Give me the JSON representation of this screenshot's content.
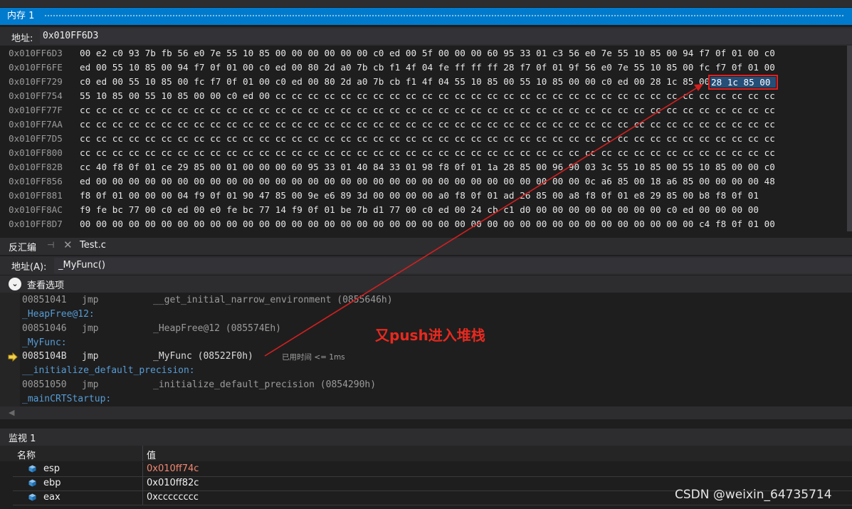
{
  "memory": {
    "title": "内存 1",
    "address_label": "地址:",
    "address_value": "0x010FF6D3",
    "rows": [
      {
        "addr": "0x010FF6D3",
        "bytes": "00 e2 c0 93 7b fb 56 e0 7e 55 10 85 00 00 00 00 00 00 c0 ed 00 5f 00 00 00 60 95 33 01 c3 56 e0 7e 55 10 85 00 94 f7 0f 01 00 c0"
      },
      {
        "addr": "0x010FF6FE",
        "bytes": "ed 00 55 10 85 00 94 f7 0f 01 00 c0 ed 00 80 2d a0 7b cb f1 4f 04 fe ff ff ff 28 f7 0f 01 9f 56 e0 7e 55 10 85 00 fc f7 0f 01 00"
      },
      {
        "addr": "0x010FF729",
        "bytes": "c0 ed 00 55 10 85 00 fc f7 0f 01 00 c0 ed 00 80 2d a0 7b cb f1 4f 04 55 10 85 00 55 10 85 00 00 c0 ed 00 28 1c 85 00 67 45 23 01"
      },
      {
        "addr": "0x010FF754",
        "bytes": "55 10 85 00 55 10 85 00 00 c0 ed 00 cc cc cc cc cc cc cc cc cc cc cc cc cc cc cc cc cc cc cc cc cc cc cc cc cc cc cc cc cc cc cc"
      },
      {
        "addr": "0x010FF77F",
        "bytes": "cc cc cc cc cc cc cc cc cc cc cc cc cc cc cc cc cc cc cc cc cc cc cc cc cc cc cc cc cc cc cc cc cc cc cc cc cc cc cc cc cc cc cc"
      },
      {
        "addr": "0x010FF7AA",
        "bytes": "cc cc cc cc cc cc cc cc cc cc cc cc cc cc cc cc cc cc cc cc cc cc cc cc cc cc cc cc cc cc cc cc cc cc cc cc cc cc cc cc cc cc cc"
      },
      {
        "addr": "0x010FF7D5",
        "bytes": "cc cc cc cc cc cc cc cc cc cc cc cc cc cc cc cc cc cc cc cc cc cc cc cc cc cc cc cc cc cc cc cc cc cc cc cc cc cc cc cc cc cc cc"
      },
      {
        "addr": "0x010FF800",
        "bytes": "cc cc cc cc cc cc cc cc cc cc cc cc cc cc cc cc cc cc cc cc cc cc cc cc cc cc cc cc cc cc cc cc cc cc cc cc cc cc cc cc cc cc cc"
      },
      {
        "addr": "0x010FF82B",
        "bytes": "cc 40 f8 0f 01 ce 29 85 00 01 00 00 00 60 95 33 01 40 84 33 01 98 f8 0f 01 1a 28 85 00 96 90 03 3c 55 10 85 00 55 10 85 00 00 c0"
      },
      {
        "addr": "0x010FF856",
        "bytes": "ed 00 00 00 00 00 00 00 00 00 00 00 00 00 00 00 00 00 00 00 00 00 00 00 00 00 00 00 00 00 00 0c a6 85 00 18 a6 85 00 00 00 00 48"
      },
      {
        "addr": "0x010FF881",
        "bytes": "f8 0f 01 00 00 00 04 f9 0f 01 90 47 85 00 9e e6 89 3d 00 00 00 00 a0 f8 0f 01 ad 26 85 00 a8 f8 0f 01 e8 29 85 00 b8 f8 0f 01"
      },
      {
        "addr": "0x010FF8AC",
        "bytes": "f9 fe bc 77 00 c0 ed 00 e0 fe bc 77 14 f9 0f 01 be 7b d1 77 00 c0 ed 00 24 cb c1 d0 00 00 00 00 00 00 00 00 c0 ed 00 00 00 00"
      },
      {
        "addr": "0x010FF8D7",
        "bytes": "00 00 00 00 00 00 00 00 00 00 00 00 00 00 00 00 00 00 00 00 00 00 00 00 00 00 00 00 00 00 00 00 00 00 00 00 00 00 c4 f8 0f 01 00"
      }
    ],
    "highlight": "28 1c 85 00"
  },
  "disassembly": {
    "tab_label": "反汇编",
    "pin_icon": "pin-icon",
    "file_tab": "Test.c",
    "address_label": "地址(A):",
    "address_value": "_MyFunc()",
    "view_options": "查看选项",
    "lines": [
      {
        "kind": "code",
        "addr": "00851041",
        "op": "jmp",
        "arg": "__get_initial_narrow_environment (0855646h)"
      },
      {
        "kind": "label",
        "text": "_HeapFree@12:"
      },
      {
        "kind": "code",
        "addr": "00851046",
        "op": "jmp",
        "arg": "_HeapFree@12 (085574Eh)"
      },
      {
        "kind": "label",
        "text": "_MyFunc:"
      },
      {
        "kind": "code",
        "addr": "0085104B",
        "op": "jmp",
        "arg": "_MyFunc (08522F0h)",
        "current": true
      },
      {
        "kind": "label",
        "text": "__initialize_default_precision:"
      },
      {
        "kind": "code",
        "addr": "00851050",
        "op": "jmp",
        "arg": "_initialize_default_precision (0854290h)"
      },
      {
        "kind": "label",
        "text": "_mainCRTStartup:"
      }
    ],
    "perf_tip": "已用时间 <= 1ms",
    "annotation": "又push进入堆栈"
  },
  "watch": {
    "title": "监视 1",
    "col_name": "名称",
    "col_value": "值",
    "rows": [
      {
        "name": "esp",
        "value": "0x010ff74c",
        "changed": true
      },
      {
        "name": "ebp",
        "value": "0x010ff82c",
        "changed": false
      },
      {
        "name": "eax",
        "value": "0xcccccccc",
        "changed": false
      }
    ]
  },
  "watermark": "CSDN @weixin_64735714",
  "colors": {
    "accent": "#007acc",
    "annotation": "#e8291f",
    "changed_value": "#f48771",
    "label": "#569cd6"
  }
}
